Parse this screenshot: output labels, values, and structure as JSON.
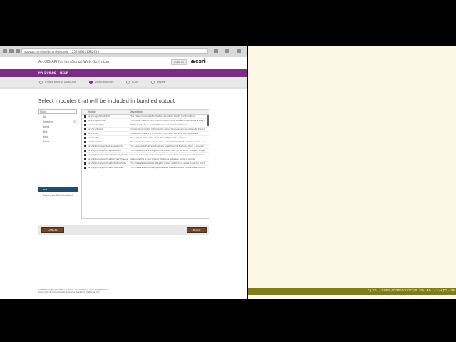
{
  "browser": {
    "url": "jsuavgs.com/build/config/config_1257983411382819"
  },
  "app": {
    "title": "ArcGIS API for JavaScript Web Optimizer",
    "signin": "SIGN IN",
    "logo": "esri",
    "nav": [
      "MY BUILDS",
      "HELP"
    ]
  },
  "steps": [
    {
      "num": "1",
      "label": "Create a set of Dojo/Dijit"
    },
    {
      "num": "2",
      "label": "Select Modules"
    },
    {
      "num": "3",
      "label": "Build"
    },
    {
      "num": "4",
      "label": "Review"
    }
  ],
  "section_title": "Select modules that will be included in bundled output",
  "filter_placeholder": "Filter",
  "modules": [
    {
      "label": "All",
      "count": ""
    },
    {
      "label": "Selected",
      "count": "(0)"
    },
    {
      "label": "dgrid",
      "count": ""
    },
    {
      "label": "dijit",
      "count": ""
    },
    {
      "label": "dojo",
      "count": ""
    },
    {
      "label": "dojox",
      "count": ""
    },
    {
      "label": "esri",
      "count": ""
    },
    {
      "label": "Advanced Optimizations",
      "count": ""
    }
  ],
  "table": {
    "headers": [
      "Module",
      "Description"
    ],
    "rows": [
      {
        "module": "esri/arcgis/OAuthInfo",
        "desc": "This class contains information about an OAuth configuration."
      },
      {
        "module": "esri/arcgis/Portal",
        "desc": "The Portal class is part of the ArcGIS Portal API which provides a way to build"
      },
      {
        "module": "esri/arcgis/utils",
        "desc": "Utility methods to work with content from ArcGIS.com."
      },
      {
        "module": "esri/Credential",
        "desc": "Credential provides information about the user access token to the ArcGIS"
      },
      {
        "module": "esri/Color",
        "desc": "Creates an instance of color for use with symbols and renderers."
      },
      {
        "module": "esri/config",
        "desc": "The default values for all JS API configuration options."
      },
      {
        "module": "esri/Credential",
        "desc": "The Credential class represents a credential object used to access a secure resource."
      },
      {
        "module": "esri/dijit/AnalysisAggregatePoints",
        "desc": "The AggregatePoints widget works with point features from a polygon layer."
      },
      {
        "module": "esri/dijit/analysis/CreateBuffers",
        "desc": "The CreateBuffers widget is the base class for all other analysis widgets."
      },
      {
        "module": "esri/dijit/analysis/CreateDensitySurface",
        "desc": "Creates a density map from point or line features by spreading known quantities."
      },
      {
        "module": "esri/dijit/analysis/CreateDriveTimeAreas",
        "desc": "Measures the travel time or distance between pairs of points."
      },
      {
        "module": "esri/dijit/analysis/CreateWatersheds",
        "desc": "The CreateWatersheds widget creates catchment areas based on locations you specify."
      },
      {
        "module": "esri/dijit/analysis/CreateViewshed",
        "desc": "The CreateViewshed widget creates areas that are visible based on observer locations."
      }
    ]
  },
  "buttons": {
    "cancel": "CANCEL",
    "build": "BUILD"
  },
  "footer": [
    "Please contact the team to share comments or give suggestions.",
    "Copyright Environmental Systems Research Institute, Inc."
  ],
  "terminal": {
    "status": "*[sh  /home/odev/Docum  06:46 23-Apr-14"
  }
}
